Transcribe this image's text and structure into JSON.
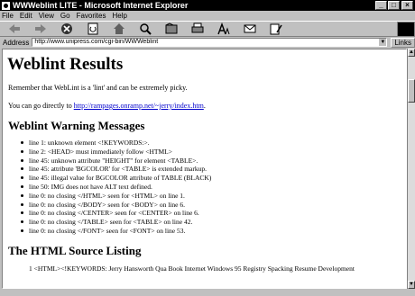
{
  "window": {
    "title": "WWWeblint LITE - Microsoft Internet Explorer",
    "minimize": "_",
    "maximize": "□",
    "close": "×"
  },
  "menu": {
    "items": [
      "File",
      "Edit",
      "View",
      "Go",
      "Favorites",
      "Help"
    ]
  },
  "toolbar": {
    "buttons": [
      "back-icon",
      "forward-icon",
      "stop-icon",
      "refresh-icon",
      "home-icon",
      "search-icon",
      "favorites-icon",
      "print-icon",
      "font-icon",
      "mail-icon",
      "edit-icon"
    ]
  },
  "address": {
    "label": "Address",
    "url": "http://www.unipress.com/cgi-bin/WWWeblint",
    "links_label": "Links"
  },
  "page": {
    "heading": "Weblint Results",
    "intro": "Remember that WebLint is a 'lint' and can be extremely picky.",
    "direct_prefix": "You can go directly to ",
    "direct_link": "http://rampages.onramp.net/~jerry/index.htm",
    "direct_suffix": ".",
    "warnings_heading": "Weblint Warning Messages",
    "warnings": [
      "line 1: unknown element <!KEYWORDS:>.",
      "line 2: <HEAD> must immediately follow <HTML>",
      "line 45: unknown attribute \"HEIGHT\" for element <TABLE>.",
      "line 45: attribute 'BGCOLOR' for <TABLE> is extended markup.",
      "line 45: illegal value for BGCOLOR attribute of TABLE (BLACK)",
      "line 50: IMG does not have ALT text defined.",
      "line 0: no closing </HTML> seen for <HTML> on line 1.",
      "line 0: no closing </BODY> seen for <BODY> on line 6.",
      "line 0: no closing </CENTER> seen for <CENTER> on line 6.",
      "line 0: no closing </TABLE> seen for <TABLE> on line 42.",
      "line 0: no closing </FONT> seen for <FONT> on line 53."
    ],
    "source_heading": "The HTML Source Listing",
    "source_first_line": "1   <HTML><!KEYWORDS: Jerry Hansworth Qua Book Internet Windows 95 Registry Spacking Resume Development"
  },
  "colors": {
    "link": "#0000cc",
    "chrome": "#c0c0c0",
    "titlebar": "#000000"
  }
}
